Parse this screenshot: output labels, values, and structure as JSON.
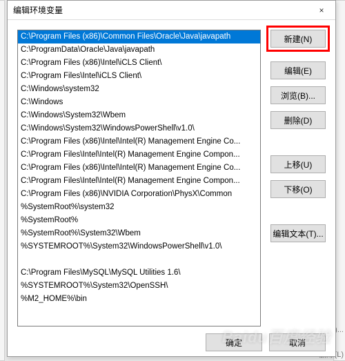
{
  "dialog": {
    "title": "编辑环境变量",
    "close_icon": "×"
  },
  "list": {
    "items": [
      "C:\\Program Files (x86)\\Common Files\\Oracle\\Java\\javapath",
      "C:\\ProgramData\\Oracle\\Java\\javapath",
      "C:\\Program Files (x86)\\Intel\\iCLS Client\\",
      "C:\\Program Files\\Intel\\iCLS Client\\",
      "C:\\Windows\\system32",
      "C:\\Windows",
      "C:\\Windows\\System32\\Wbem",
      "C:\\Windows\\System32\\WindowsPowerShell\\v1.0\\",
      "C:\\Program Files (x86)\\Intel\\Intel(R) Management Engine Co...",
      "C:\\Program Files\\Intel\\Intel(R) Management Engine Compon...",
      "C:\\Program Files (x86)\\Intel\\Intel(R) Management Engine Co...",
      "C:\\Program Files\\Intel\\Intel(R) Management Engine Compon...",
      "C:\\Program Files (x86)\\NVIDIA Corporation\\PhysX\\Common",
      "%SystemRoot%\\system32",
      "%SystemRoot%",
      "%SystemRoot%\\System32\\Wbem",
      "%SYSTEMROOT%\\System32\\WindowsPowerShell\\v1.0\\",
      "",
      "C:\\Program Files\\MySQL\\MySQL Utilities 1.6\\",
      "%SYSTEMROOT%\\System32\\OpenSSH\\",
      "%M2_HOME%\\bin"
    ],
    "selected_index": 0
  },
  "buttons": {
    "new": "新建(N)",
    "edit": "编辑(E)",
    "browse": "浏览(B)...",
    "delete": "删除(D)",
    "move_up": "上移(U)",
    "move_down": "下移(O)",
    "edit_text": "编辑文本(T)...",
    "ok": "确定",
    "cancel": "取消"
  },
  "background": {
    "label1": "新建(W)...",
    "label2": "删除(L)"
  },
  "watermark": "Baidu百度经验"
}
